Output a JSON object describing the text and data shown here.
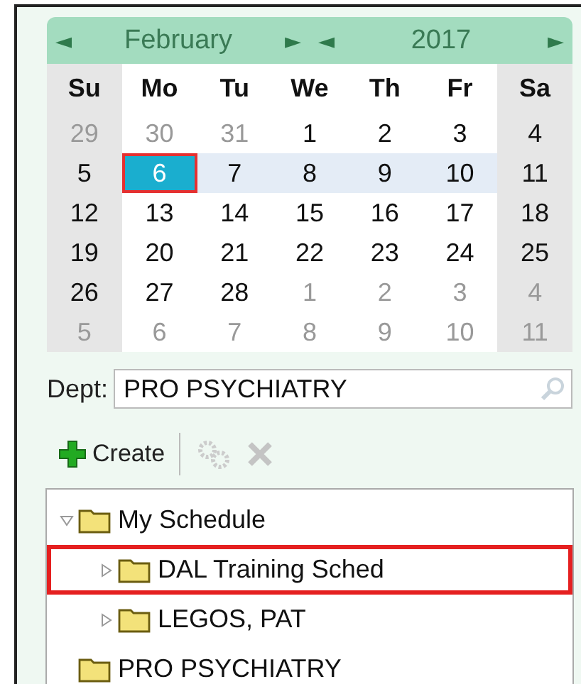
{
  "calendar": {
    "month": "February",
    "year": "2017",
    "prev_month": "◄",
    "next_month": "►",
    "prev_year": "◄",
    "next_year": "►",
    "weekdays": [
      "Su",
      "Mo",
      "Tu",
      "We",
      "Th",
      "Fr",
      "Sa"
    ],
    "weeks": [
      {
        "selected": false,
        "days": [
          {
            "text": "29",
            "outside": true,
            "selected": false
          },
          {
            "text": "30",
            "outside": true,
            "selected": false
          },
          {
            "text": "31",
            "outside": true,
            "selected": false
          },
          {
            "text": "1",
            "outside": false,
            "selected": false
          },
          {
            "text": "2",
            "outside": false,
            "selected": false
          },
          {
            "text": "3",
            "outside": false,
            "selected": false
          },
          {
            "text": "4",
            "outside": false,
            "selected": false
          }
        ]
      },
      {
        "selected": true,
        "days": [
          {
            "text": "5",
            "outside": false,
            "selected": false
          },
          {
            "text": "6",
            "outside": false,
            "selected": true
          },
          {
            "text": "7",
            "outside": false,
            "selected": false
          },
          {
            "text": "8",
            "outside": false,
            "selected": false
          },
          {
            "text": "9",
            "outside": false,
            "selected": false
          },
          {
            "text": "10",
            "outside": false,
            "selected": false
          },
          {
            "text": "11",
            "outside": false,
            "selected": false
          }
        ]
      },
      {
        "selected": false,
        "days": [
          {
            "text": "12",
            "outside": false,
            "selected": false
          },
          {
            "text": "13",
            "outside": false,
            "selected": false
          },
          {
            "text": "14",
            "outside": false,
            "selected": false
          },
          {
            "text": "15",
            "outside": false,
            "selected": false
          },
          {
            "text": "16",
            "outside": false,
            "selected": false
          },
          {
            "text": "17",
            "outside": false,
            "selected": false
          },
          {
            "text": "18",
            "outside": false,
            "selected": false
          }
        ]
      },
      {
        "selected": false,
        "days": [
          {
            "text": "19",
            "outside": false,
            "selected": false
          },
          {
            "text": "20",
            "outside": false,
            "selected": false
          },
          {
            "text": "21",
            "outside": false,
            "selected": false
          },
          {
            "text": "22",
            "outside": false,
            "selected": false
          },
          {
            "text": "23",
            "outside": false,
            "selected": false
          },
          {
            "text": "24",
            "outside": false,
            "selected": false
          },
          {
            "text": "25",
            "outside": false,
            "selected": false
          }
        ]
      },
      {
        "selected": false,
        "days": [
          {
            "text": "26",
            "outside": false,
            "selected": false
          },
          {
            "text": "27",
            "outside": false,
            "selected": false
          },
          {
            "text": "28",
            "outside": false,
            "selected": false
          },
          {
            "text": "1",
            "outside": true,
            "selected": false
          },
          {
            "text": "2",
            "outside": true,
            "selected": false
          },
          {
            "text": "3",
            "outside": true,
            "selected": false
          },
          {
            "text": "4",
            "outside": true,
            "selected": false
          }
        ]
      },
      {
        "selected": false,
        "days": [
          {
            "text": "5",
            "outside": true,
            "selected": false
          },
          {
            "text": "6",
            "outside": true,
            "selected": false
          },
          {
            "text": "7",
            "outside": true,
            "selected": false
          },
          {
            "text": "8",
            "outside": true,
            "selected": false
          },
          {
            "text": "9",
            "outside": true,
            "selected": false
          },
          {
            "text": "10",
            "outside": true,
            "selected": false
          },
          {
            "text": "11",
            "outside": true,
            "selected": false
          }
        ]
      }
    ]
  },
  "dept": {
    "label": "Dept:",
    "value": "PRO PSYCHIATRY"
  },
  "toolbar": [
    {
      "kind": "create",
      "label": "Create",
      "disabled": false
    },
    {
      "kind": "settings",
      "disabled": true
    },
    {
      "kind": "delete",
      "disabled": true
    }
  ],
  "tree": [
    {
      "label": "My Schedule",
      "toggle": true,
      "expanded": true,
      "highlighted": false,
      "children": [
        {
          "label": "DAL Training Sched",
          "toggle": true,
          "expanded": false,
          "highlighted": true
        },
        {
          "label": "LEGOS, PAT",
          "toggle": true,
          "expanded": false,
          "highlighted": false
        }
      ]
    },
    {
      "label": "PRO PSYCHIATRY",
      "toggle": false,
      "highlighted": false
    }
  ]
}
